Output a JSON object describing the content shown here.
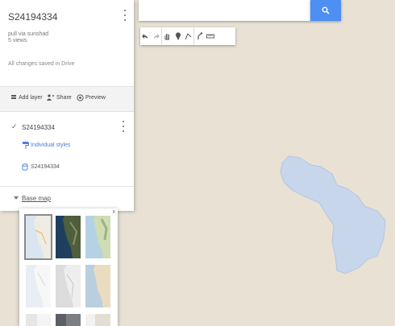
{
  "map_name": "S24194334",
  "map_description": "pull via sunshad",
  "views": "5 views",
  "save_status": "All changes saved in Drive",
  "actions": {
    "add_layer": "Add layer",
    "share": "Share",
    "preview": "Preview"
  },
  "layer": {
    "name": "S24194334",
    "style_link": "Individual styles",
    "dataset": "S24194334"
  },
  "basemap": {
    "toggle_label": "Base map",
    "close": "x",
    "thumbnails": [
      "map",
      "satellite",
      "terrain",
      "light political",
      "mono city",
      "simple atlas",
      "light landmass",
      "dark landmass",
      "whitewater"
    ]
  },
  "colors": {
    "map_background": "#e8e1d4",
    "polygon_fill": "#c8d6ec",
    "accent": "#4d8ff2",
    "link": "#4a7ed9"
  },
  "toolbar_icons": [
    "undo-icon",
    "redo-icon",
    "hand-icon",
    "marker-icon",
    "line-icon",
    "route-icon",
    "ruler-icon"
  ]
}
